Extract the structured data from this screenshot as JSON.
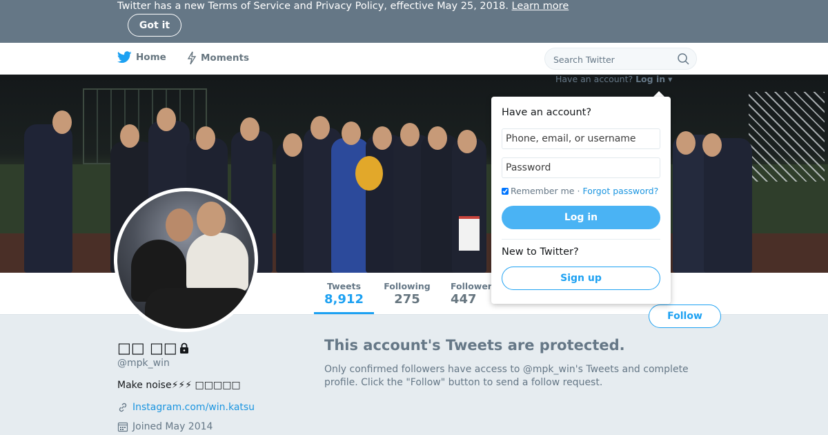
{
  "banner": {
    "message": "Twitter has a new Terms of Service and Privacy Policy, effective May 25, 2018.",
    "link": "Learn more",
    "dismiss": "Got it"
  },
  "nav": {
    "home": "Home",
    "moments": "Moments",
    "search_placeholder": "Search Twitter"
  },
  "login": {
    "toggle_prefix": "Have an account?",
    "toggle_action": "Log in",
    "title": "Have an account?",
    "username_placeholder": "Phone, email, or username",
    "password_placeholder": "Password",
    "remember": "Remember me",
    "separator": "·",
    "forgot": "Forgot password?",
    "submit": "Log in",
    "new_prompt": "New to Twitter?",
    "signup": "Sign up"
  },
  "stats": [
    {
      "label": "Tweets",
      "value": "8,912"
    },
    {
      "label": "Following",
      "value": "275"
    },
    {
      "label": "Followers",
      "value": "447"
    }
  ],
  "profile": {
    "name": "□□ □□",
    "screen_name": "@mpk_win",
    "bio": "Make noise⚡⚡⚡ □□□□□",
    "link": "Instagram.com/win.katsu",
    "joined": "Joined May 2014",
    "follow": "Follow"
  },
  "protected": {
    "title": "This account's Tweets are protected.",
    "text": "Only confirmed followers have access to @mpk_win's Tweets and complete profile. Click the \"Follow\" button to send a follow request."
  },
  "icons": {
    "home": "twitter-bird-icon",
    "moments": "lightning-icon",
    "search": "search-icon",
    "lock": "lock-icon",
    "link": "link-icon",
    "calendar": "calendar-icon"
  },
  "colors": {
    "accent": "#1da1f2",
    "banner": "#657786",
    "background": "#e6ecf0"
  }
}
